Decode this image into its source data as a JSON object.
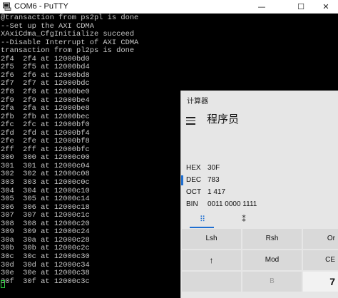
{
  "putty": {
    "title": "COM6 - PuTTY",
    "controls": {
      "minimize": "—",
      "maximize": "☐",
      "close": "✕"
    },
    "lines": [
      "@transaction from ps2pl is done",
      "--Set up the AXI CDMA",
      "XAxiCdma_CfgInitialize succeed",
      "--Disable Interrupt of AXI CDMA",
      "transaction from pl2ps is done",
      "2f4  2f4 at 12000bd0",
      "2f5  2f5 at 12000bd4",
      "2f6  2f6 at 12000bd8",
      "2f7  2f7 at 12000bdc",
      "2f8  2f8 at 12000be0",
      "2f9  2f9 at 12000be4",
      "2fa  2fa at 12000be8",
      "2fb  2fb at 12000bec",
      "2fc  2fc at 12000bf0",
      "2fd  2fd at 12000bf4",
      "2fe  2fe at 12000bf8",
      "2ff  2ff at 12000bfc",
      "300  300 at 12000c00",
      "301  301 at 12000c04",
      "302  302 at 12000c08",
      "303  303 at 12000c0c",
      "304  304 at 12000c10",
      "305  305 at 12000c14",
      "306  306 at 12000c18",
      "307  307 at 12000c1c",
      "308  308 at 12000c20",
      "309  309 at 12000c24",
      "30a  30a at 12000c28",
      "30b  30b at 12000c2c",
      "30c  30c at 12000c30",
      "30d  30d at 12000c34",
      "30e  30e at 12000c38",
      "30f  30f at 12000c3c"
    ]
  },
  "calculator": {
    "window_title": "计算器",
    "mode": "程序员",
    "bases": [
      {
        "name": "HEX",
        "value": "30F",
        "active": false
      },
      {
        "name": "DEC",
        "value": "783",
        "active": true
      },
      {
        "name": "OCT",
        "value": "1 417",
        "active": false
      },
      {
        "name": "BIN",
        "value": "0011 0000 1111",
        "active": false
      }
    ],
    "tabs": {
      "keypad_icon": "⠿",
      "bit_icon": "⁑"
    },
    "keys": {
      "lsh": "Lsh",
      "rsh": "Rsh",
      "or": "Or",
      "up": "↑",
      "mod": "Mod",
      "ce": "CE",
      "b": "B",
      "seven": "7"
    }
  },
  "colors": {
    "accent": "#1f6fd1",
    "terminal_text": "#c8c8c8",
    "cursor": "#2ecc40"
  }
}
